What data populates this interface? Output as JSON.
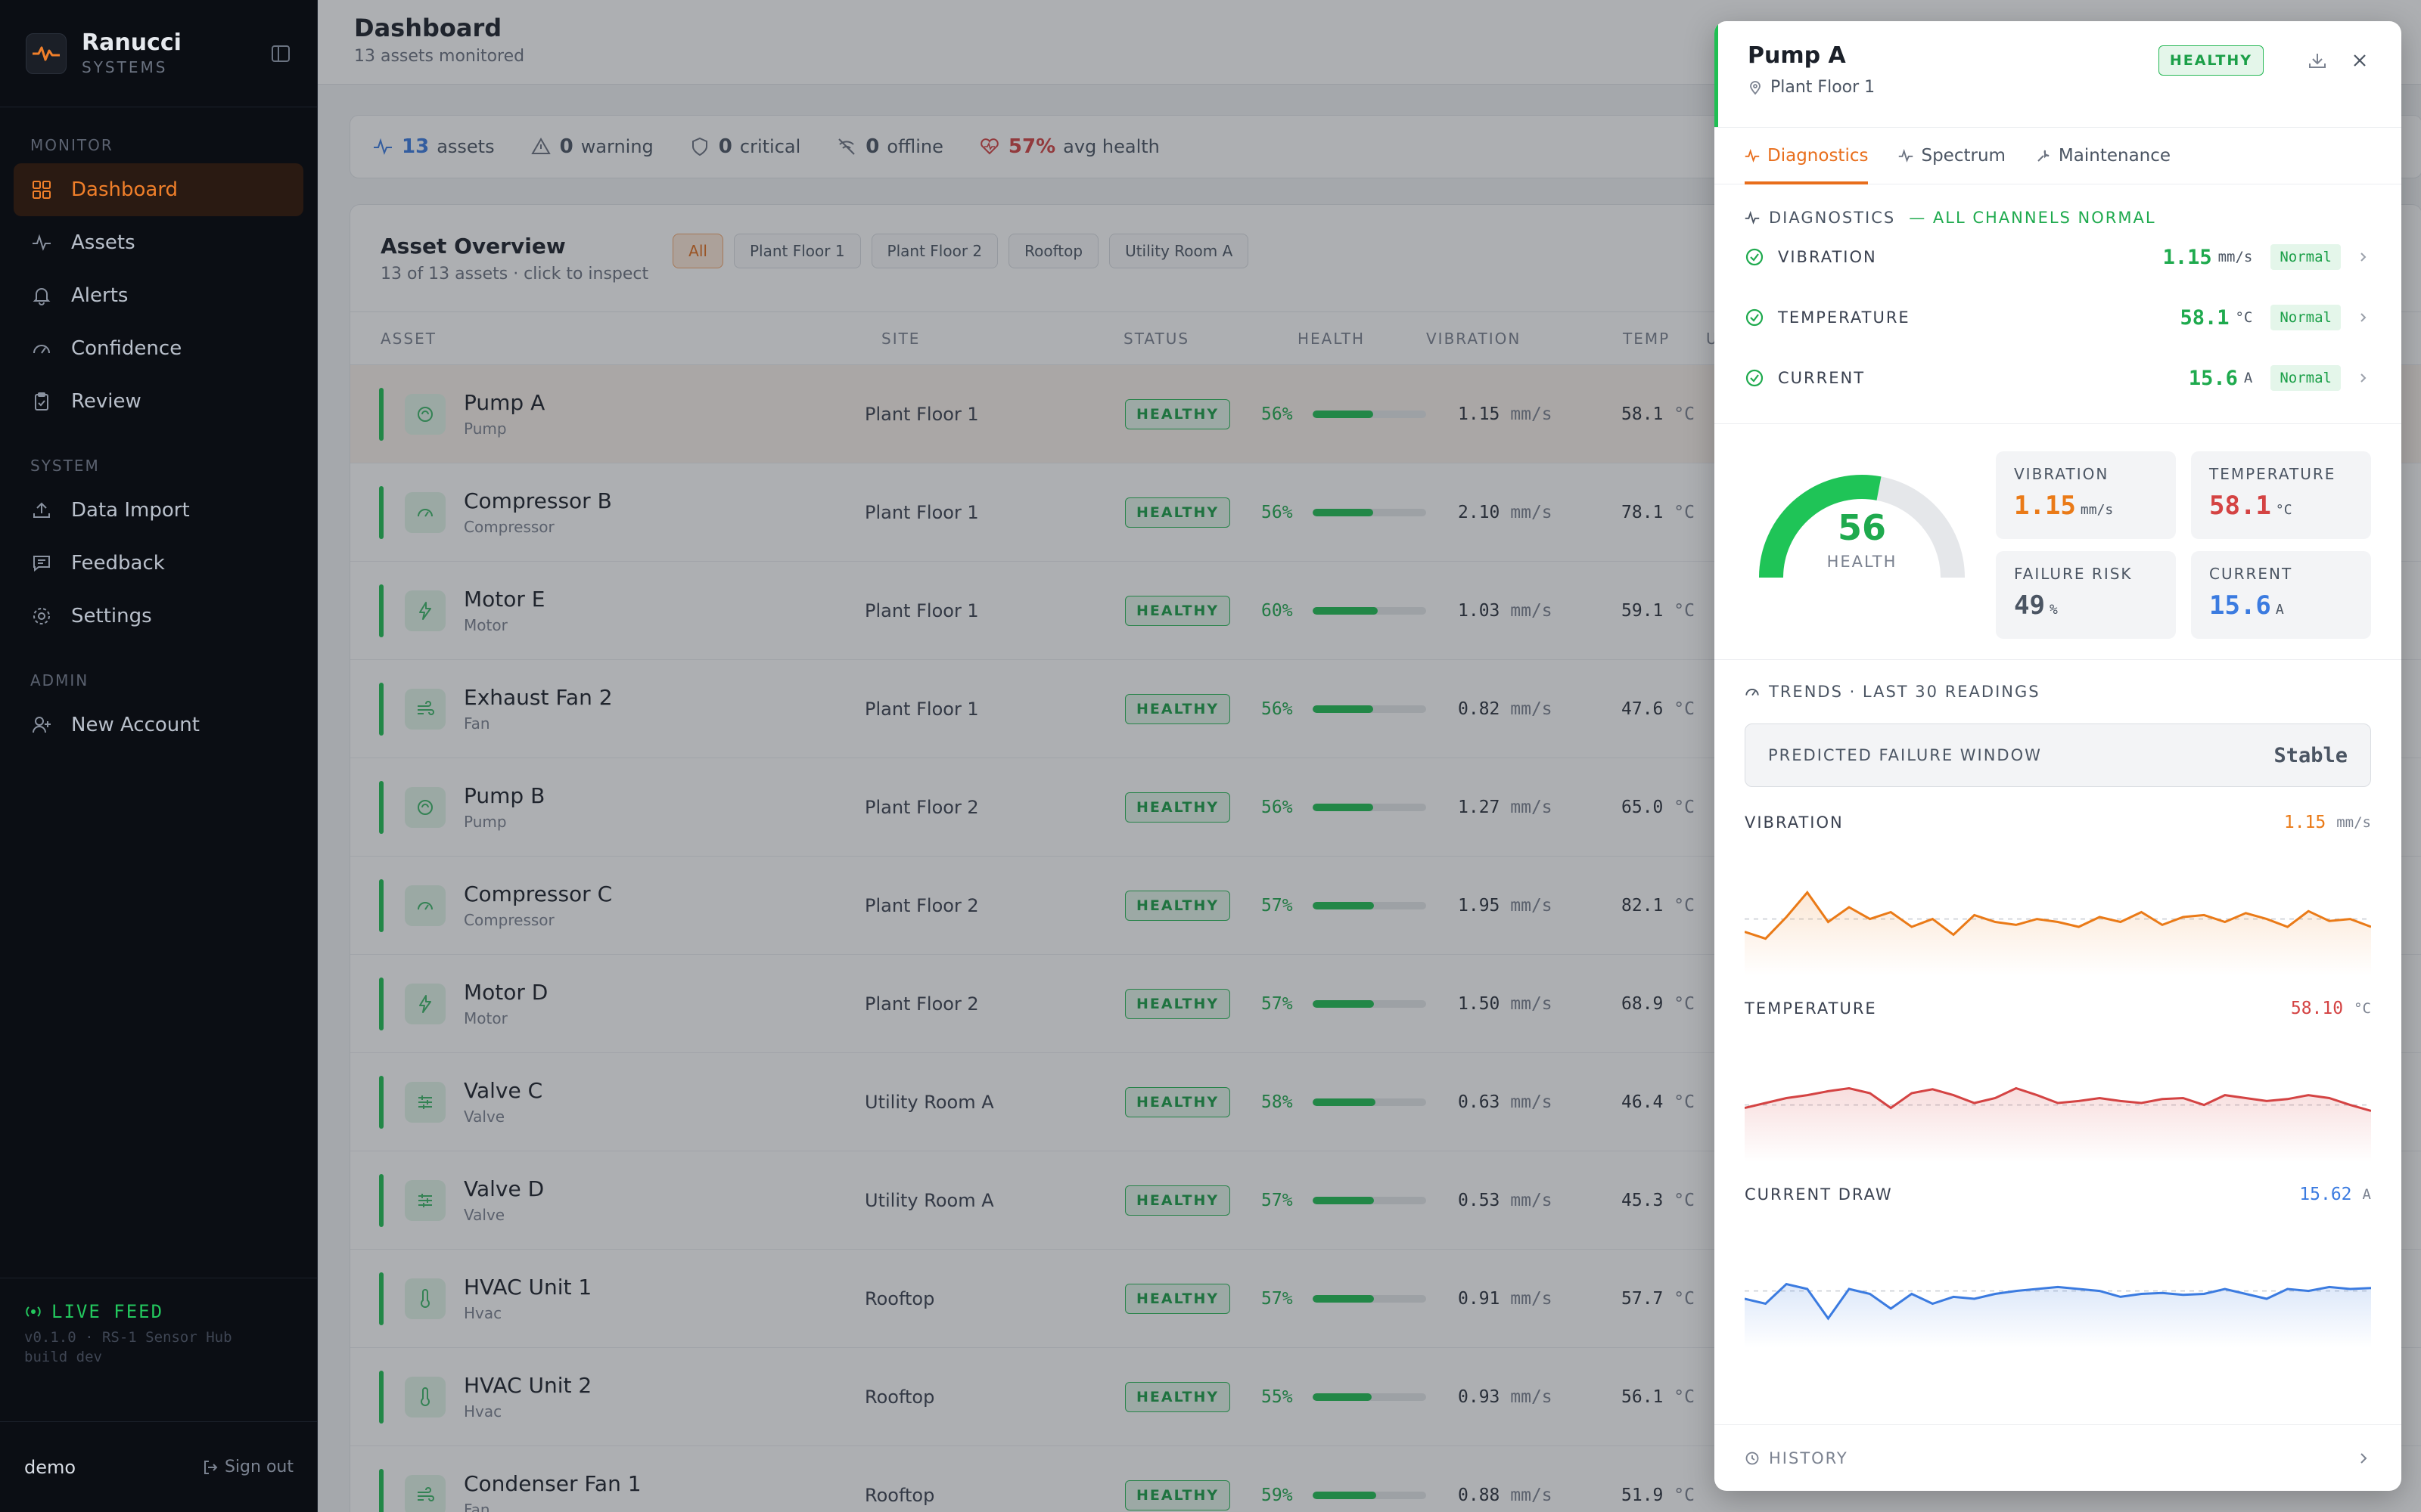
{
  "brand": {
    "name": "Ranucci",
    "sub": "SYSTEMS"
  },
  "nav": {
    "monitor_label": "MONITOR",
    "system_label": "SYSTEM",
    "admin_label": "ADMIN",
    "monitor": [
      {
        "label": "Dashboard",
        "icon": "dashboard-icon"
      },
      {
        "label": "Assets",
        "icon": "activity-icon"
      },
      {
        "label": "Alerts",
        "icon": "bell-icon"
      },
      {
        "label": "Confidence",
        "icon": "gauge-icon"
      },
      {
        "label": "Review",
        "icon": "clipboard-icon"
      }
    ],
    "system": [
      {
        "label": "Data Import",
        "icon": "upload-icon"
      },
      {
        "label": "Feedback",
        "icon": "message-icon"
      },
      {
        "label": "Settings",
        "icon": "gear-icon"
      }
    ],
    "admin": [
      {
        "label": "New Account",
        "icon": "user-plus-icon"
      }
    ]
  },
  "live": {
    "title": "LIVE FEED",
    "meta1": "v0.1.0 · RS-1 Sensor Hub",
    "meta2": "build dev"
  },
  "user": {
    "name": "demo",
    "signout": "Sign out"
  },
  "header": {
    "title": "Dashboard",
    "subtitle": "13 assets monitored"
  },
  "stats": {
    "assets": "13",
    "assets_label": "assets",
    "warning": "0",
    "warning_label": "warning",
    "critical": "0",
    "critical_label": "critical",
    "offline": "0",
    "offline_label": "offline",
    "avg": "57%",
    "avg_label": "avg health"
  },
  "overview": {
    "title": "Asset Overview",
    "subtitle": "13 of 13 assets · click to inspect",
    "filters": [
      "All",
      "Plant Floor 1",
      "Plant Floor 2",
      "Rooftop",
      "Utility Room A"
    ],
    "columns": [
      "ASSET",
      "SITE",
      "STATUS",
      "HEALTH",
      "VIBRATION",
      "TEMP",
      "U"
    ],
    "status_label": "HEALTHY",
    "vib_unit": "mm/s",
    "temp_unit": "°C",
    "rows": [
      {
        "name": "Pump A",
        "type": "Pump",
        "site": "Plant Floor 1",
        "health": 56,
        "health_label": "56%",
        "vib": "1.15",
        "temp": "58.1"
      },
      {
        "name": "Compressor B",
        "type": "Compressor",
        "site": "Plant Floor 1",
        "health": 56,
        "health_label": "56%",
        "vib": "2.10",
        "temp": "78.1"
      },
      {
        "name": "Motor E",
        "type": "Motor",
        "site": "Plant Floor 1",
        "health": 60,
        "health_label": "60%",
        "vib": "1.03",
        "temp": "59.1"
      },
      {
        "name": "Exhaust Fan 2",
        "type": "Fan",
        "site": "Plant Floor 1",
        "health": 56,
        "health_label": "56%",
        "vib": "0.82",
        "temp": "47.6"
      },
      {
        "name": "Pump B",
        "type": "Pump",
        "site": "Plant Floor 2",
        "health": 56,
        "health_label": "56%",
        "vib": "1.27",
        "temp": "65.0"
      },
      {
        "name": "Compressor C",
        "type": "Compressor",
        "site": "Plant Floor 2",
        "health": 57,
        "health_label": "57%",
        "vib": "1.95",
        "temp": "82.1"
      },
      {
        "name": "Motor D",
        "type": "Motor",
        "site": "Plant Floor 2",
        "health": 57,
        "health_label": "57%",
        "vib": "1.50",
        "temp": "68.9"
      },
      {
        "name": "Valve C",
        "type": "Valve",
        "site": "Utility Room A",
        "health": 58,
        "health_label": "58%",
        "vib": "0.63",
        "temp": "46.4"
      },
      {
        "name": "Valve D",
        "type": "Valve",
        "site": "Utility Room A",
        "health": 57,
        "health_label": "57%",
        "vib": "0.53",
        "temp": "45.3"
      },
      {
        "name": "HVAC Unit 1",
        "type": "Hvac",
        "site": "Rooftop",
        "health": 57,
        "health_label": "57%",
        "vib": "0.91",
        "temp": "57.7"
      },
      {
        "name": "HVAC Unit 2",
        "type": "Hvac",
        "site": "Rooftop",
        "health": 55,
        "health_label": "55%",
        "vib": "0.93",
        "temp": "56.1"
      },
      {
        "name": "Condenser Fan 1",
        "type": "Fan",
        "site": "Rooftop",
        "health": 59,
        "health_label": "59%",
        "vib": "0.88",
        "temp": "51.9"
      }
    ]
  },
  "panel": {
    "title": "Pump A",
    "location": "Plant Floor 1",
    "badge": "HEALTHY",
    "tabs": [
      "Diagnostics",
      "Spectrum",
      "Maintenance"
    ],
    "diag_title": "DIAGNOSTICS",
    "diag_status": "— ALL CHANNELS NORMAL",
    "channels": [
      {
        "label": "VIBRATION",
        "value": "1.15",
        "unit": "mm/s",
        "status": "Normal"
      },
      {
        "label": "TEMPERATURE",
        "value": "58.1",
        "unit": "°C",
        "status": "Normal"
      },
      {
        "label": "CURRENT",
        "value": "15.6",
        "unit": "A",
        "status": "Normal"
      }
    ],
    "health": 56,
    "health_value": "56",
    "health_label": "HEALTH",
    "tiles": {
      "vibration_label": "VIBRATION",
      "vibration_value": "1.15",
      "vibration_unit": "mm/s",
      "temperature_label": "TEMPERATURE",
      "temperature_value": "58.1",
      "temperature_unit": "°C",
      "risk_label": "FAILURE RISK",
      "risk_value": "49",
      "risk_unit": "%",
      "current_label": "CURRENT",
      "current_value": "15.6",
      "current_unit": "A"
    },
    "trends_title": "TRENDS · LAST 30 READINGS",
    "pfw_label": "PREDICTED FAILURE WINDOW",
    "pfw_value": "Stable",
    "sparks": [
      {
        "label": "VIBRATION",
        "value": "1.15",
        "unit": "mm/s",
        "color": "#ea7a17"
      },
      {
        "label": "TEMPERATURE",
        "value": "58.10",
        "unit": "°C",
        "color": "#d44343"
      },
      {
        "label": "CURRENT DRAW",
        "value": "15.62",
        "unit": "A",
        "color": "#3b7be0"
      }
    ],
    "history_label": "HISTORY"
  },
  "colors": {
    "accent": "#e86e1c",
    "healthy": "#1fbf53",
    "sidebar": "#0b0e14"
  }
}
